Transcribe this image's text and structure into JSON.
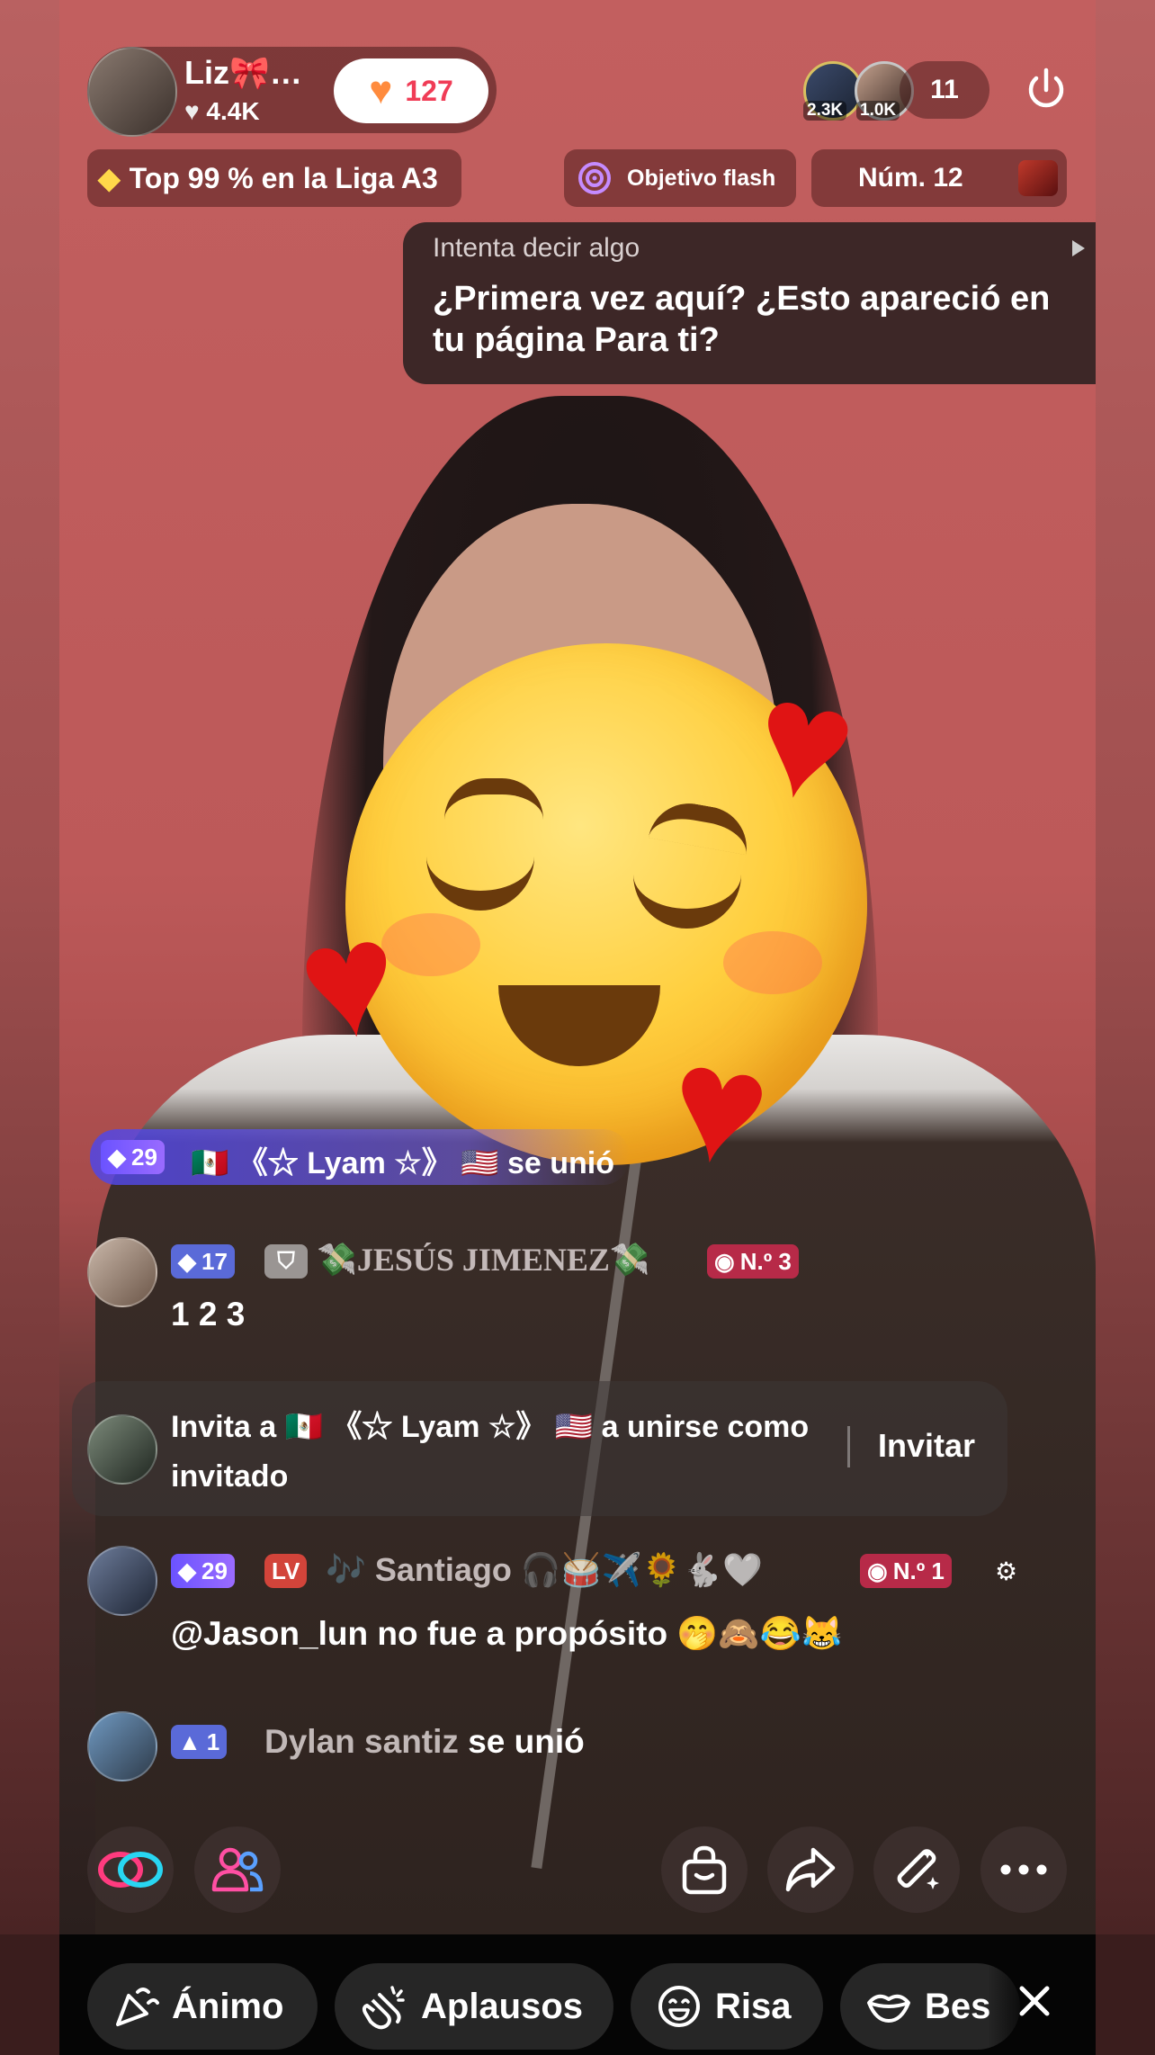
{
  "host": {
    "name": "Liz🎀…",
    "likes": "4.4K",
    "like_count_label": "127",
    "league": "Top 99 % en la Liga A3"
  },
  "viewers": {
    "avatar1_count": "2.3K",
    "avatar2_count": "1.0K",
    "total": "11"
  },
  "chips": {
    "flash_goal": "Objetivo flash",
    "rank": "Núm. 12"
  },
  "tooltip": {
    "hint": "Intenta decir algo",
    "text": "¿Primera vez aquí? ¿Esto apareció en tu página Para ti?"
  },
  "join_banner": {
    "level": "29",
    "flag_left": "🇲🇽",
    "name": "《☆ Lyam ☆》",
    "flag_right": "🇺🇸",
    "action": "se unió"
  },
  "chat": [
    {
      "level": "17",
      "name": "💸JESÚS JIMENEZ💸",
      "rank": "N.º 3",
      "message": "1 2 3"
    },
    {
      "level": "29",
      "lv_badge": "LV",
      "name": "🎶 Santiago 🎧🥁✈️🌻🐇🤍",
      "rank": "N.º 1",
      "message": "@Jason_lun  no fue a propósito 🤭🙈😂😹"
    },
    {
      "level": "1",
      "name": "Dylan santiz",
      "message": "se unió"
    }
  ],
  "invite": {
    "text_pre": "Invita a",
    "flag_left": "🇲🇽",
    "name": "《☆ Lyam ☆》",
    "flag_right": "🇺🇸",
    "text_post": "a unirse como",
    "text_line2": "invitado",
    "button": "Invitar"
  },
  "quick_reactions": [
    {
      "label": "Ánimo",
      "icon": "party-popper-icon"
    },
    {
      "label": "Aplausos",
      "icon": "clapping-hands-icon"
    },
    {
      "label": "Risa",
      "icon": "laughing-face-icon"
    },
    {
      "label": "Bes",
      "icon": "kiss-lips-icon"
    }
  ],
  "colors": {
    "follow_text": "#f03c56",
    "level_badge": "#7b5cff",
    "rank_badge": "#b72a48"
  }
}
